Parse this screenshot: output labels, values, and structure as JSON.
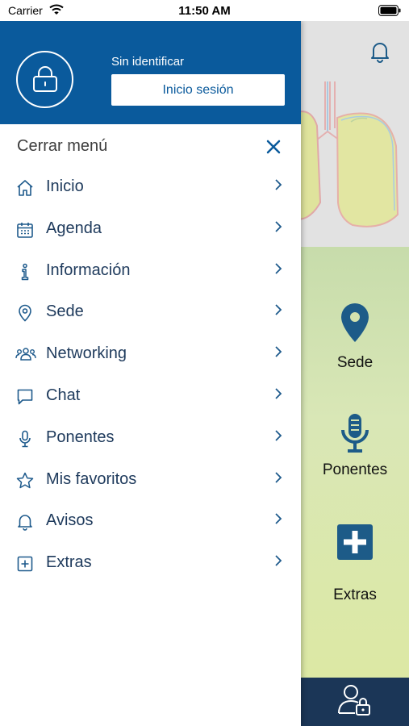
{
  "status_bar": {
    "carrier": "Carrier",
    "time": "11:50 AM"
  },
  "drawer": {
    "header": {
      "user_status": "Sin identificar",
      "login_label": "Inicio sesión",
      "background_color": "#0a5a9c"
    },
    "close_label": "Cerrar menú",
    "menu_items": [
      {
        "label": "Inicio",
        "icon": "home-icon"
      },
      {
        "label": "Agenda",
        "icon": "calendar-icon"
      },
      {
        "label": "Información",
        "icon": "info-icon"
      },
      {
        "label": "Sede",
        "icon": "location-pin-icon"
      },
      {
        "label": "Networking",
        "icon": "people-icon"
      },
      {
        "label": "Chat",
        "icon": "chat-bubble-icon"
      },
      {
        "label": "Ponentes",
        "icon": "microphone-icon"
      },
      {
        "label": "Mis favoritos",
        "icon": "star-icon"
      },
      {
        "label": "Avisos",
        "icon": "bell-icon"
      },
      {
        "label": "Extras",
        "icon": "plus-square-icon"
      }
    ]
  },
  "background_app": {
    "tiles": [
      {
        "label": "Sede",
        "icon": "location-pin-icon"
      },
      {
        "label": "Ponentes",
        "icon": "microphone-icon"
      },
      {
        "label": "Extras",
        "icon": "plus-square-icon"
      }
    ],
    "bottom_bar_color": "#1b3657",
    "accent_color": "#1d5b88"
  }
}
